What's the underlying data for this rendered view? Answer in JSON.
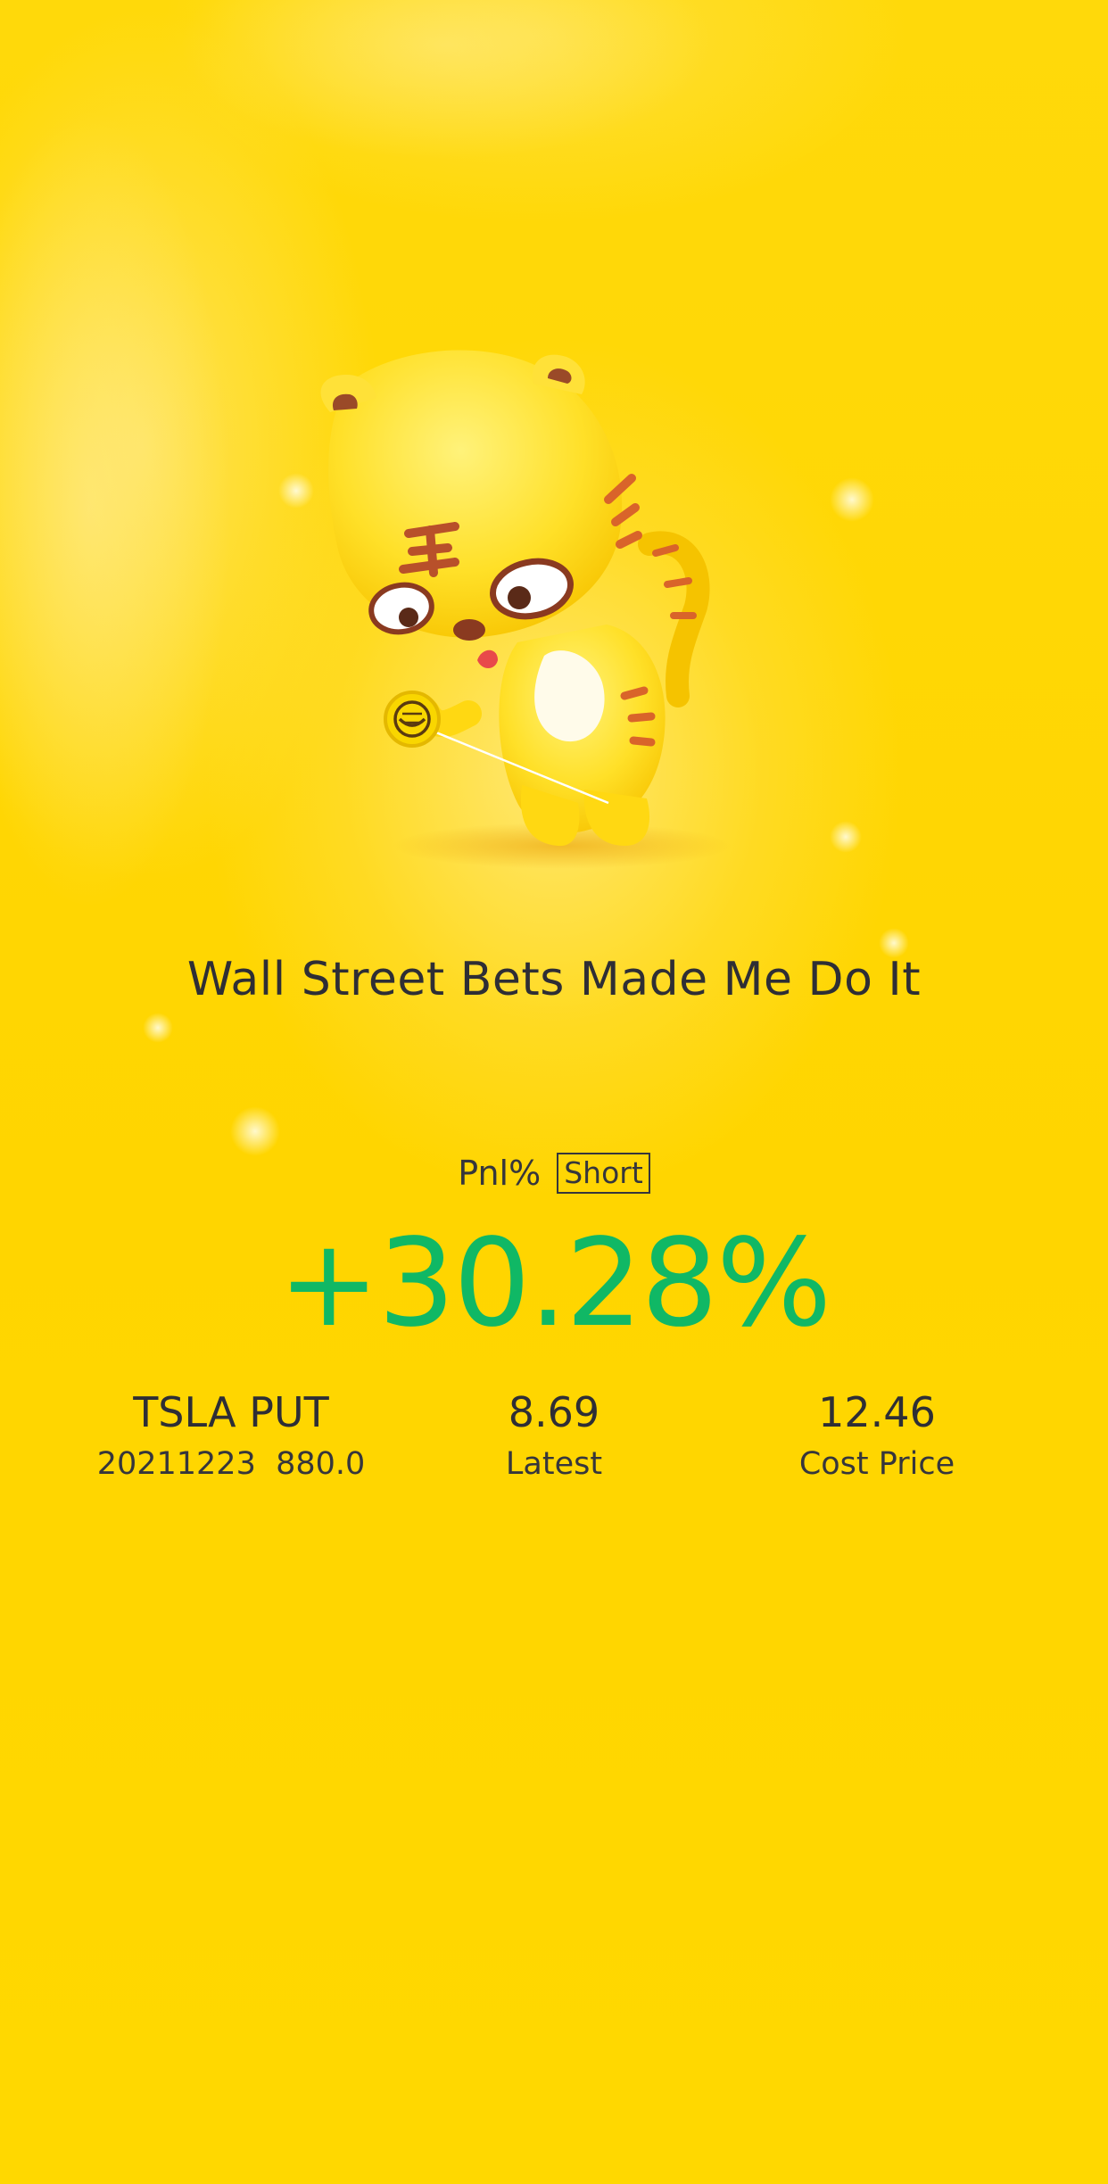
{
  "card": {
    "title": "Wall Street Bets Made Me Do It",
    "pnl_label": "Pnl%",
    "direction_badge": "Short",
    "pnl_value": "+30.28%",
    "pnl_color": "#10B865",
    "background_color": "#FFD600"
  },
  "position": {
    "symbol": "TSLA PUT",
    "expiry_strike": "20211223  880.0",
    "latest_value": "8.69",
    "latest_label": "Latest",
    "cost_value": "12.46",
    "cost_label": "Cost Price"
  },
  "mascot": {
    "icon": "tiger-mascot-yoyo-icon"
  }
}
